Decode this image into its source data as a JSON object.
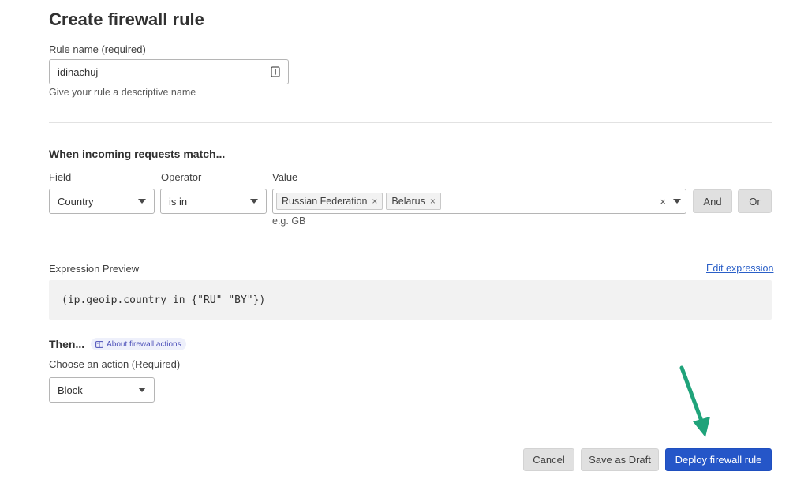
{
  "page": {
    "title": "Create firewall rule"
  },
  "rule_name": {
    "label": "Rule name (required)",
    "value": "idinachuj",
    "help": "Give your rule a descriptive name",
    "icon": "form-fill-icon"
  },
  "match": {
    "heading": "When incoming requests match...",
    "field_label": "Field",
    "operator_label": "Operator",
    "value_label": "Value",
    "field_value": "Country",
    "operator_value": "is in",
    "chips": [
      "Russian Federation",
      "Belarus"
    ],
    "chip_remove": "×",
    "clear": "×",
    "value_hint": "e.g. GB",
    "and_label": "And",
    "or_label": "Or"
  },
  "expression": {
    "label": "Expression Preview",
    "edit_link": "Edit expression",
    "code": "(ip.geoip.country in {\"RU\" \"BY\"})"
  },
  "then": {
    "heading": "Then...",
    "about_link": "About firewall actions",
    "action_label": "Choose an action (Required)",
    "action_value": "Block"
  },
  "footer": {
    "cancel": "Cancel",
    "save_draft": "Save as Draft",
    "deploy": "Deploy firewall rule"
  },
  "colors": {
    "primary": "#2556c8",
    "annotation_arrow": "#1fa37a"
  }
}
